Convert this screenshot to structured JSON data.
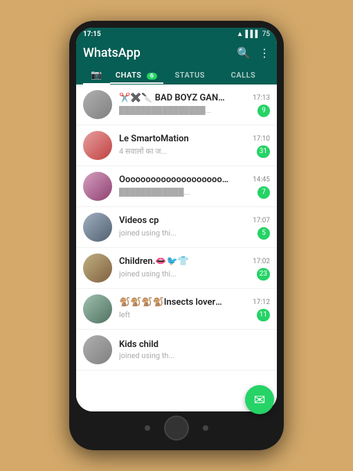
{
  "statusBar": {
    "time": "17:15",
    "battery": "75",
    "signal": "oo"
  },
  "header": {
    "title": "WhatsApp",
    "searchIcon": "🔍",
    "moreIcon": "⋮"
  },
  "tabs": [
    {
      "id": "camera",
      "label": "📷",
      "active": false,
      "badge": null
    },
    {
      "id": "chats",
      "label": "CHATS",
      "active": true,
      "badge": "6"
    },
    {
      "id": "status",
      "label": "STATUS",
      "active": false,
      "badge": null
    },
    {
      "id": "calls",
      "label": "CALLS",
      "active": false,
      "badge": null
    }
  ],
  "chats": [
    {
      "id": 1,
      "name": "✂️✖️🔪 BAD BOYZ GANG...",
      "preview": "████████████████...",
      "time": "17:13",
      "badge": "9",
      "avatarClass": "avatar-color1"
    },
    {
      "id": 2,
      "name": "Le SmartoMation",
      "preview": "4 सवालों का ज...",
      "time": "17:10",
      "badge": "31",
      "avatarClass": "avatar-color2"
    },
    {
      "id": 3,
      "name": "Oooooooooooooooooooooo...",
      "preview": "████████████...",
      "time": "14:45",
      "badge": "7",
      "avatarClass": "avatar-color3"
    },
    {
      "id": 4,
      "name": "Videos  cp",
      "preview": "joined using thi...",
      "time": "17:07",
      "badge": "5",
      "avatarClass": "avatar-color4"
    },
    {
      "id": 5,
      "name": "Children.👄🐦👕",
      "preview": "joined using thi...",
      "time": "17:02",
      "badge": "23",
      "avatarClass": "avatar-color5"
    },
    {
      "id": 6,
      "name": "🐒🐒🐒🐒Insects lover🐒🐒...",
      "preview": "left",
      "time": "17:12",
      "badge": "11",
      "avatarClass": "avatar-color6"
    },
    {
      "id": 7,
      "name": "Kids child",
      "preview": "joined using th...",
      "time": "",
      "badge": null,
      "avatarClass": "avatar-color1"
    }
  ],
  "fab": {
    "icon": "✉",
    "label": "New Chat"
  }
}
